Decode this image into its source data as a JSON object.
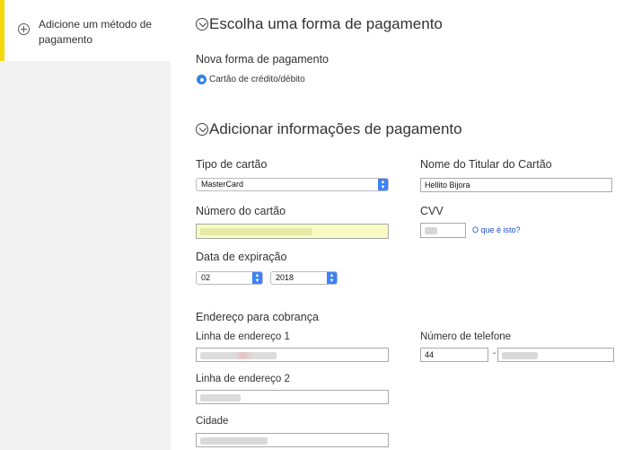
{
  "sidebar": {
    "item_label": "Adicione um método de pagamento"
  },
  "section1": {
    "title": "Escolha uma forma de pagamento",
    "subtitle": "Nova forma de pagamento",
    "radio_label": "Cartão de crédito/débito"
  },
  "section2": {
    "title": "Adicionar informações de pagamento",
    "card_type": {
      "label": "Tipo de cartão",
      "value": "MasterCard"
    },
    "holder_name": {
      "label": "Nome do Titular do Cartão",
      "value": "Hellito Bijora"
    },
    "card_number": {
      "label": "Número do cartão"
    },
    "cvv": {
      "label": "CVV",
      "help_link": "O que é isto?"
    },
    "expiration": {
      "label": "Data de expiração",
      "month": "02",
      "year": "2018"
    },
    "billing": {
      "heading": "Endereço para cobrança",
      "address1_label": "Linha de endereço 1",
      "address2_label": "Linha de endereço 2",
      "city_label": "Cidade",
      "phone_label": "Número de telefone",
      "phone_area": "44",
      "phone_separator": "-"
    }
  },
  "colors": {
    "accent_yellow": "#f5d80b",
    "select_blue": "#3b82f6",
    "link_blue": "#1a4ec9",
    "autofill_yellow": "#f8fcc2"
  }
}
